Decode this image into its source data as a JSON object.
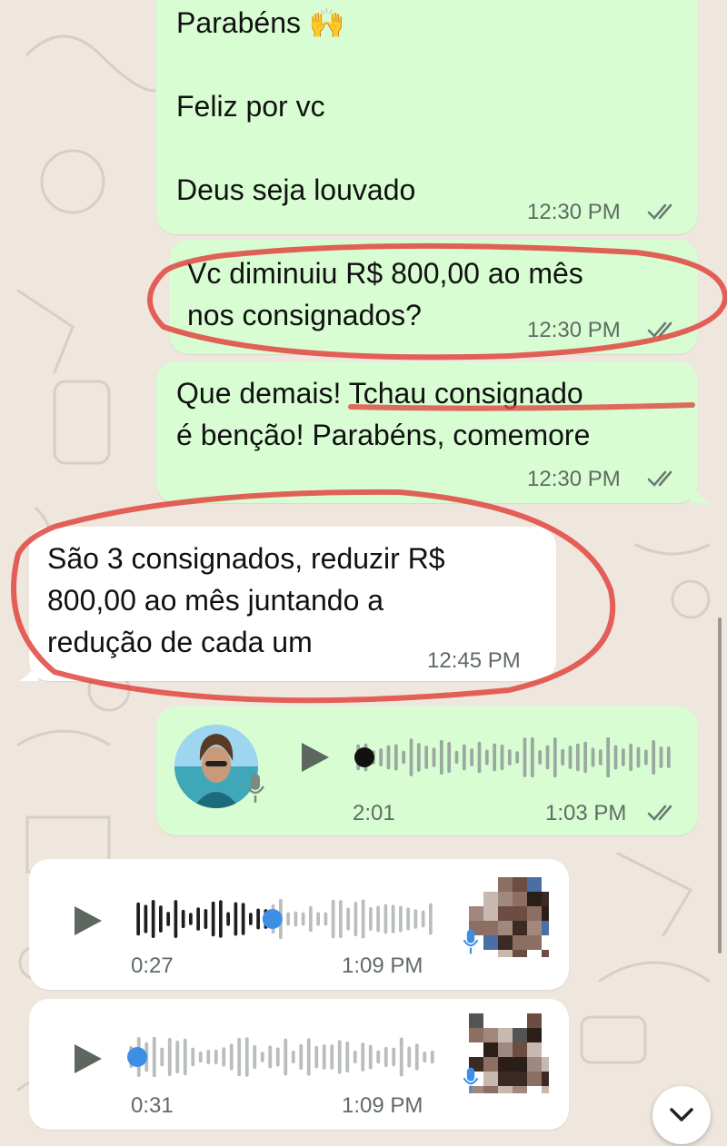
{
  "chat": {
    "messages": [
      {
        "direction": "outgoing",
        "text": "Parabéns 🙌\n\nFeliz por vc\n\nDeus seja louvado",
        "time": "12:30 PM"
      },
      {
        "direction": "outgoing",
        "text": "Vc diminuiu R$ 800,00 ao mês\nnos consignados?",
        "time": "12:30 PM"
      },
      {
        "direction": "outgoing",
        "text": "Que demais! Tchau consignado\né benção! Parabéns, comemore",
        "time": "12:30 PM"
      },
      {
        "direction": "incoming",
        "text": "São 3 consignados, reduzir R$\n800,00 ao mês juntando  a\nredução de cada um",
        "time": "12:45 PM"
      }
    ],
    "voice_notes": [
      {
        "direction": "outgoing",
        "duration": "2:01",
        "time": "1:03 PM",
        "progress": 0.0
      },
      {
        "direction": "incoming",
        "duration": "0:27",
        "time": "1:09 PM",
        "progress": 0.46
      },
      {
        "direction": "incoming",
        "duration": "0:31",
        "time": "1:09 PM",
        "progress": 0.0
      }
    ]
  },
  "colors": {
    "outgoing_bubble": "#d8fdd3",
    "incoming_bubble": "#ffffff",
    "chat_background": "#efe7de",
    "annotation_red": "#e0453f",
    "voice_progress_blue": "#3d8fe6",
    "read_ticks": "#6b7a71"
  },
  "icons": [
    "play-icon",
    "mic-icon",
    "read-receipt-icon",
    "chevron-down-icon"
  ]
}
